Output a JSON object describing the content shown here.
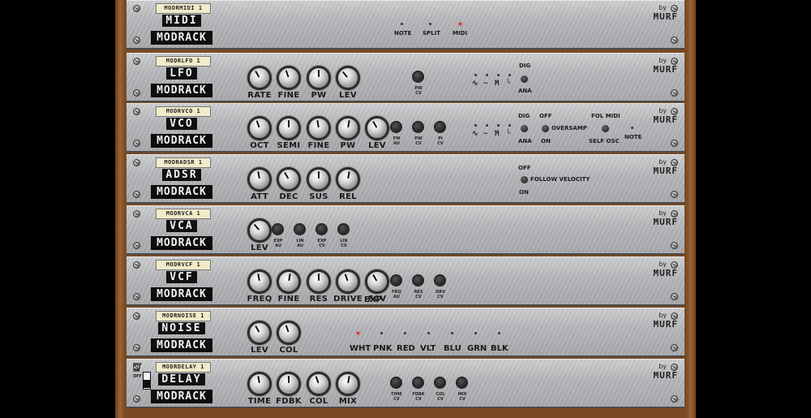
{
  "brand": "MODRACK",
  "maker_by": "by",
  "maker": "MURF",
  "modules": {
    "midi": {
      "tag": "MODRMIDI 1",
      "name": "MIDI",
      "modes": [
        "NOTE",
        "SPLIT",
        "MIDI"
      ],
      "active_mode": "MIDI"
    },
    "lfo": {
      "tag": "MODRLFO 1",
      "name": "LFO",
      "knobs": [
        "RATE",
        "FINE",
        "PW",
        "LEV"
      ],
      "cv": [
        "PW\nCV"
      ],
      "range_on": "DIG",
      "range_off": "ANA"
    },
    "vco": {
      "tag": "MODRVCO 1",
      "name": "VCO",
      "knobs": [
        "OCT",
        "SEMI",
        "FINE",
        "PW",
        "LEV"
      ],
      "cv": [
        "FM\nAU",
        "PW\nCV",
        "PI\nCV"
      ],
      "dig": "DIG",
      "ana": "ANA",
      "off": "OFF",
      "on": "ON",
      "oversamp": "OVERSAMP",
      "fol_midi": "FOL MIDI",
      "self_osc": "SELF OSC",
      "note": "NOTE"
    },
    "adsr": {
      "tag": "MODRADSR 1",
      "name": "ADSR",
      "knobs": [
        "ATT",
        "DEC",
        "SUS",
        "REL"
      ],
      "off": "OFF",
      "on": "ON",
      "follow_velocity": "FOLLOW VELOCITY"
    },
    "vca": {
      "tag": "MODRVCA 1",
      "name": "VCA",
      "knobs": [
        "LEV"
      ],
      "cv": [
        "EXP\nAU",
        "LIN\nAU",
        "EXP\nCV",
        "LIN\nCV"
      ]
    },
    "vcf": {
      "tag": "MODRVCF 1",
      "name": "VCF",
      "knobs": [
        "FREQ",
        "FINE",
        "RES",
        "DRIVE",
        "FCV"
      ],
      "exp_label": "EXP",
      "cv": [
        "FRQ\nAU",
        "RES\nCV",
        "DRV\nCV"
      ]
    },
    "noise": {
      "tag": "MODRNOISE 1",
      "name": "NOISE",
      "knobs": [
        "LEV",
        "COL"
      ],
      "colors": [
        "WHT",
        "PNK",
        "RED",
        "VLT",
        "BLU",
        "GRN",
        "BLK"
      ],
      "active_color": "WHT"
    },
    "delay": {
      "tag": "MODRDELAY 1",
      "name": "DELAY",
      "knobs": [
        "TIME",
        "FDBK",
        "COL",
        "MIX"
      ],
      "cv": [
        "TIME\nCV",
        "FDBK\nCV",
        "COL\nCV",
        "MIX\nCV"
      ],
      "byp": "BYP",
      "on": "ON",
      "off": "OFF"
    }
  }
}
